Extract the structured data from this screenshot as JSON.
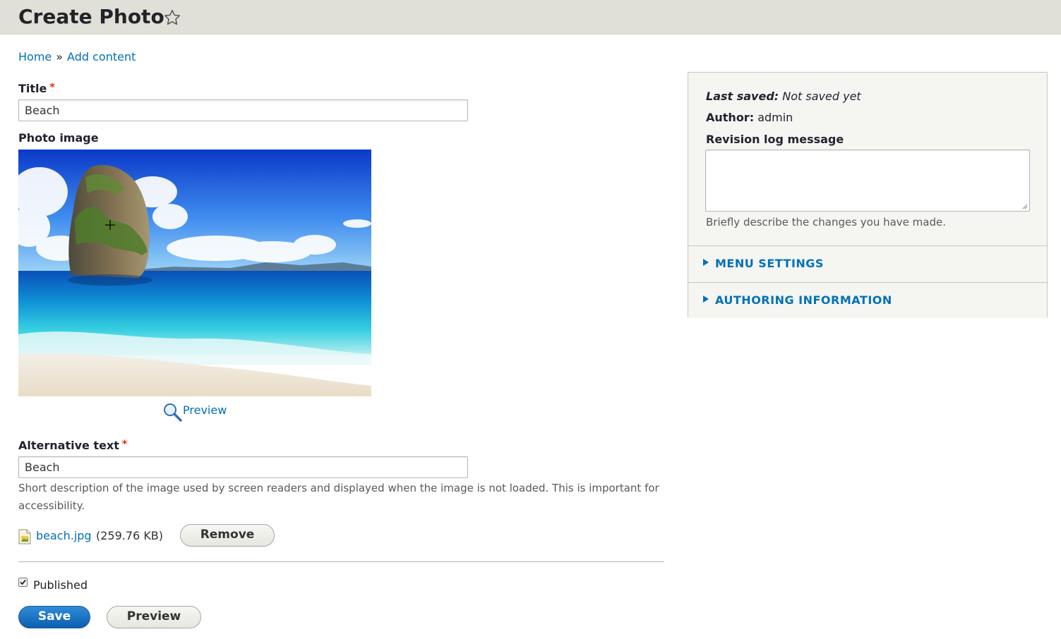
{
  "header": {
    "title": "Create Photo",
    "shortcut_icon": "star-outline-icon"
  },
  "breadcrumb": {
    "items": [
      "Home",
      "Add content"
    ],
    "separator": "»"
  },
  "form": {
    "title_label": "Title",
    "title_value": "Beach",
    "required_mark": "*",
    "photo_label": "Photo image",
    "preview_link": "Preview",
    "alt_label": "Alternative text",
    "alt_value": "Beach",
    "alt_description": "Short description of the image used by screen readers and displayed when the image is not loaded. This is important for accessibility.",
    "file_name": "beach.jpg",
    "file_size": "(259.76 KB)",
    "remove_button": "Remove",
    "published_label": "Published",
    "published_checked": true,
    "save_button": "Save",
    "preview_button": "Preview"
  },
  "sidebar": {
    "last_saved_label": "Last saved:",
    "last_saved_value": "Not saved yet",
    "author_label": "Author:",
    "author_value": "admin",
    "revision_label": "Revision log message",
    "revision_value": "",
    "revision_help": "Briefly describe the changes you have made.",
    "menu_settings": "MENU SETTINGS",
    "authoring_information": "AUTHORING INFORMATION"
  },
  "colors": {
    "link": "#0071b8",
    "primary_button": "#1b6fc2",
    "required": "#e62600",
    "header_bg": "#e0e0d8"
  }
}
